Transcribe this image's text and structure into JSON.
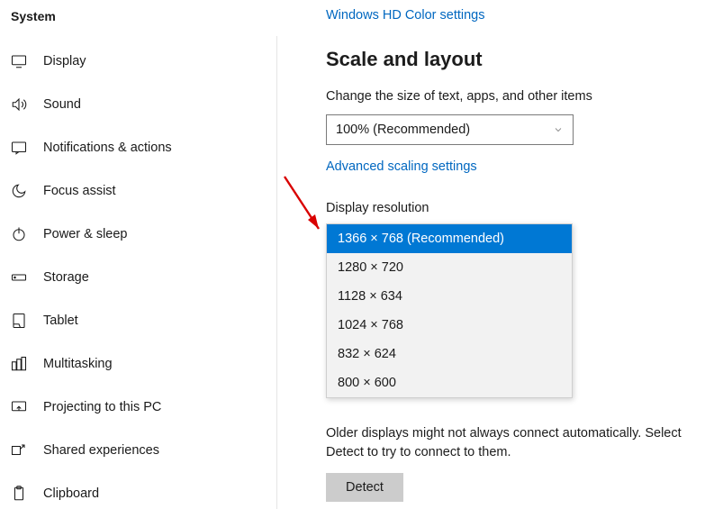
{
  "sidebar": {
    "title": "System",
    "items": [
      {
        "label": "Display"
      },
      {
        "label": "Sound"
      },
      {
        "label": "Notifications & actions"
      },
      {
        "label": "Focus assist"
      },
      {
        "label": "Power & sleep"
      },
      {
        "label": "Storage"
      },
      {
        "label": "Tablet"
      },
      {
        "label": "Multitasking"
      },
      {
        "label": "Projecting to this PC"
      },
      {
        "label": "Shared experiences"
      },
      {
        "label": "Clipboard"
      }
    ]
  },
  "main": {
    "top_link": "Windows HD Color settings",
    "heading": "Scale and layout",
    "scale_label": "Change the size of text, apps, and other items",
    "scale_value": "100% (Recommended)",
    "adv_link": "Advanced scaling settings",
    "resolution_label": "Display resolution",
    "resolution_options": [
      "1366 × 768 (Recommended)",
      "1280 × 720",
      "1128 × 634",
      "1024 × 768",
      "832 × 624",
      "800 × 600"
    ],
    "bottom_text": "Older displays might not always connect automatically. Select Detect to try to connect to them.",
    "detect_label": "Detect"
  }
}
